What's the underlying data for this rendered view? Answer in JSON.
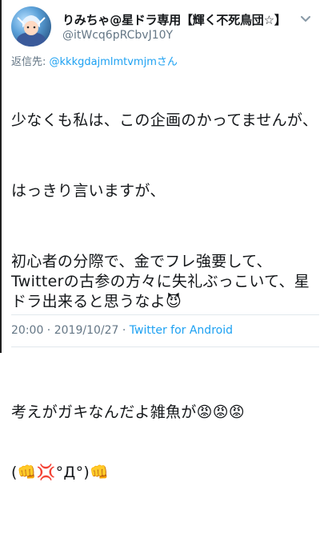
{
  "author": {
    "display_name": "りみちゃ@星ドラ専用【輝く不死鳥団☆】",
    "handle": "@itWcq6pRCbvJ10Y"
  },
  "reply": {
    "prefix": "返信先: ",
    "mention": "@kkkgdajmlmtvmjmさん"
  },
  "tweet": {
    "p1": "少なくも私は、この企画のかってませんが、",
    "p2": "はっきり言いますが、",
    "p3": "初心者の分際で、金でフレ強要して、Twitterの古参の方々に失礼ぶっこいて、星ドラ出来ると思うなよ😈",
    "p4_line1": "考えがガキなんだよ雑魚が😡😡😡",
    "p4_line2": "(👊💢°Д°)👊"
  },
  "meta": {
    "time": "20:00",
    "sep": " · ",
    "date": "2019/10/27",
    "source": "Twitter for Android"
  },
  "icons": {
    "menu": "chevron-down-icon",
    "avatar": "avatar-image"
  }
}
